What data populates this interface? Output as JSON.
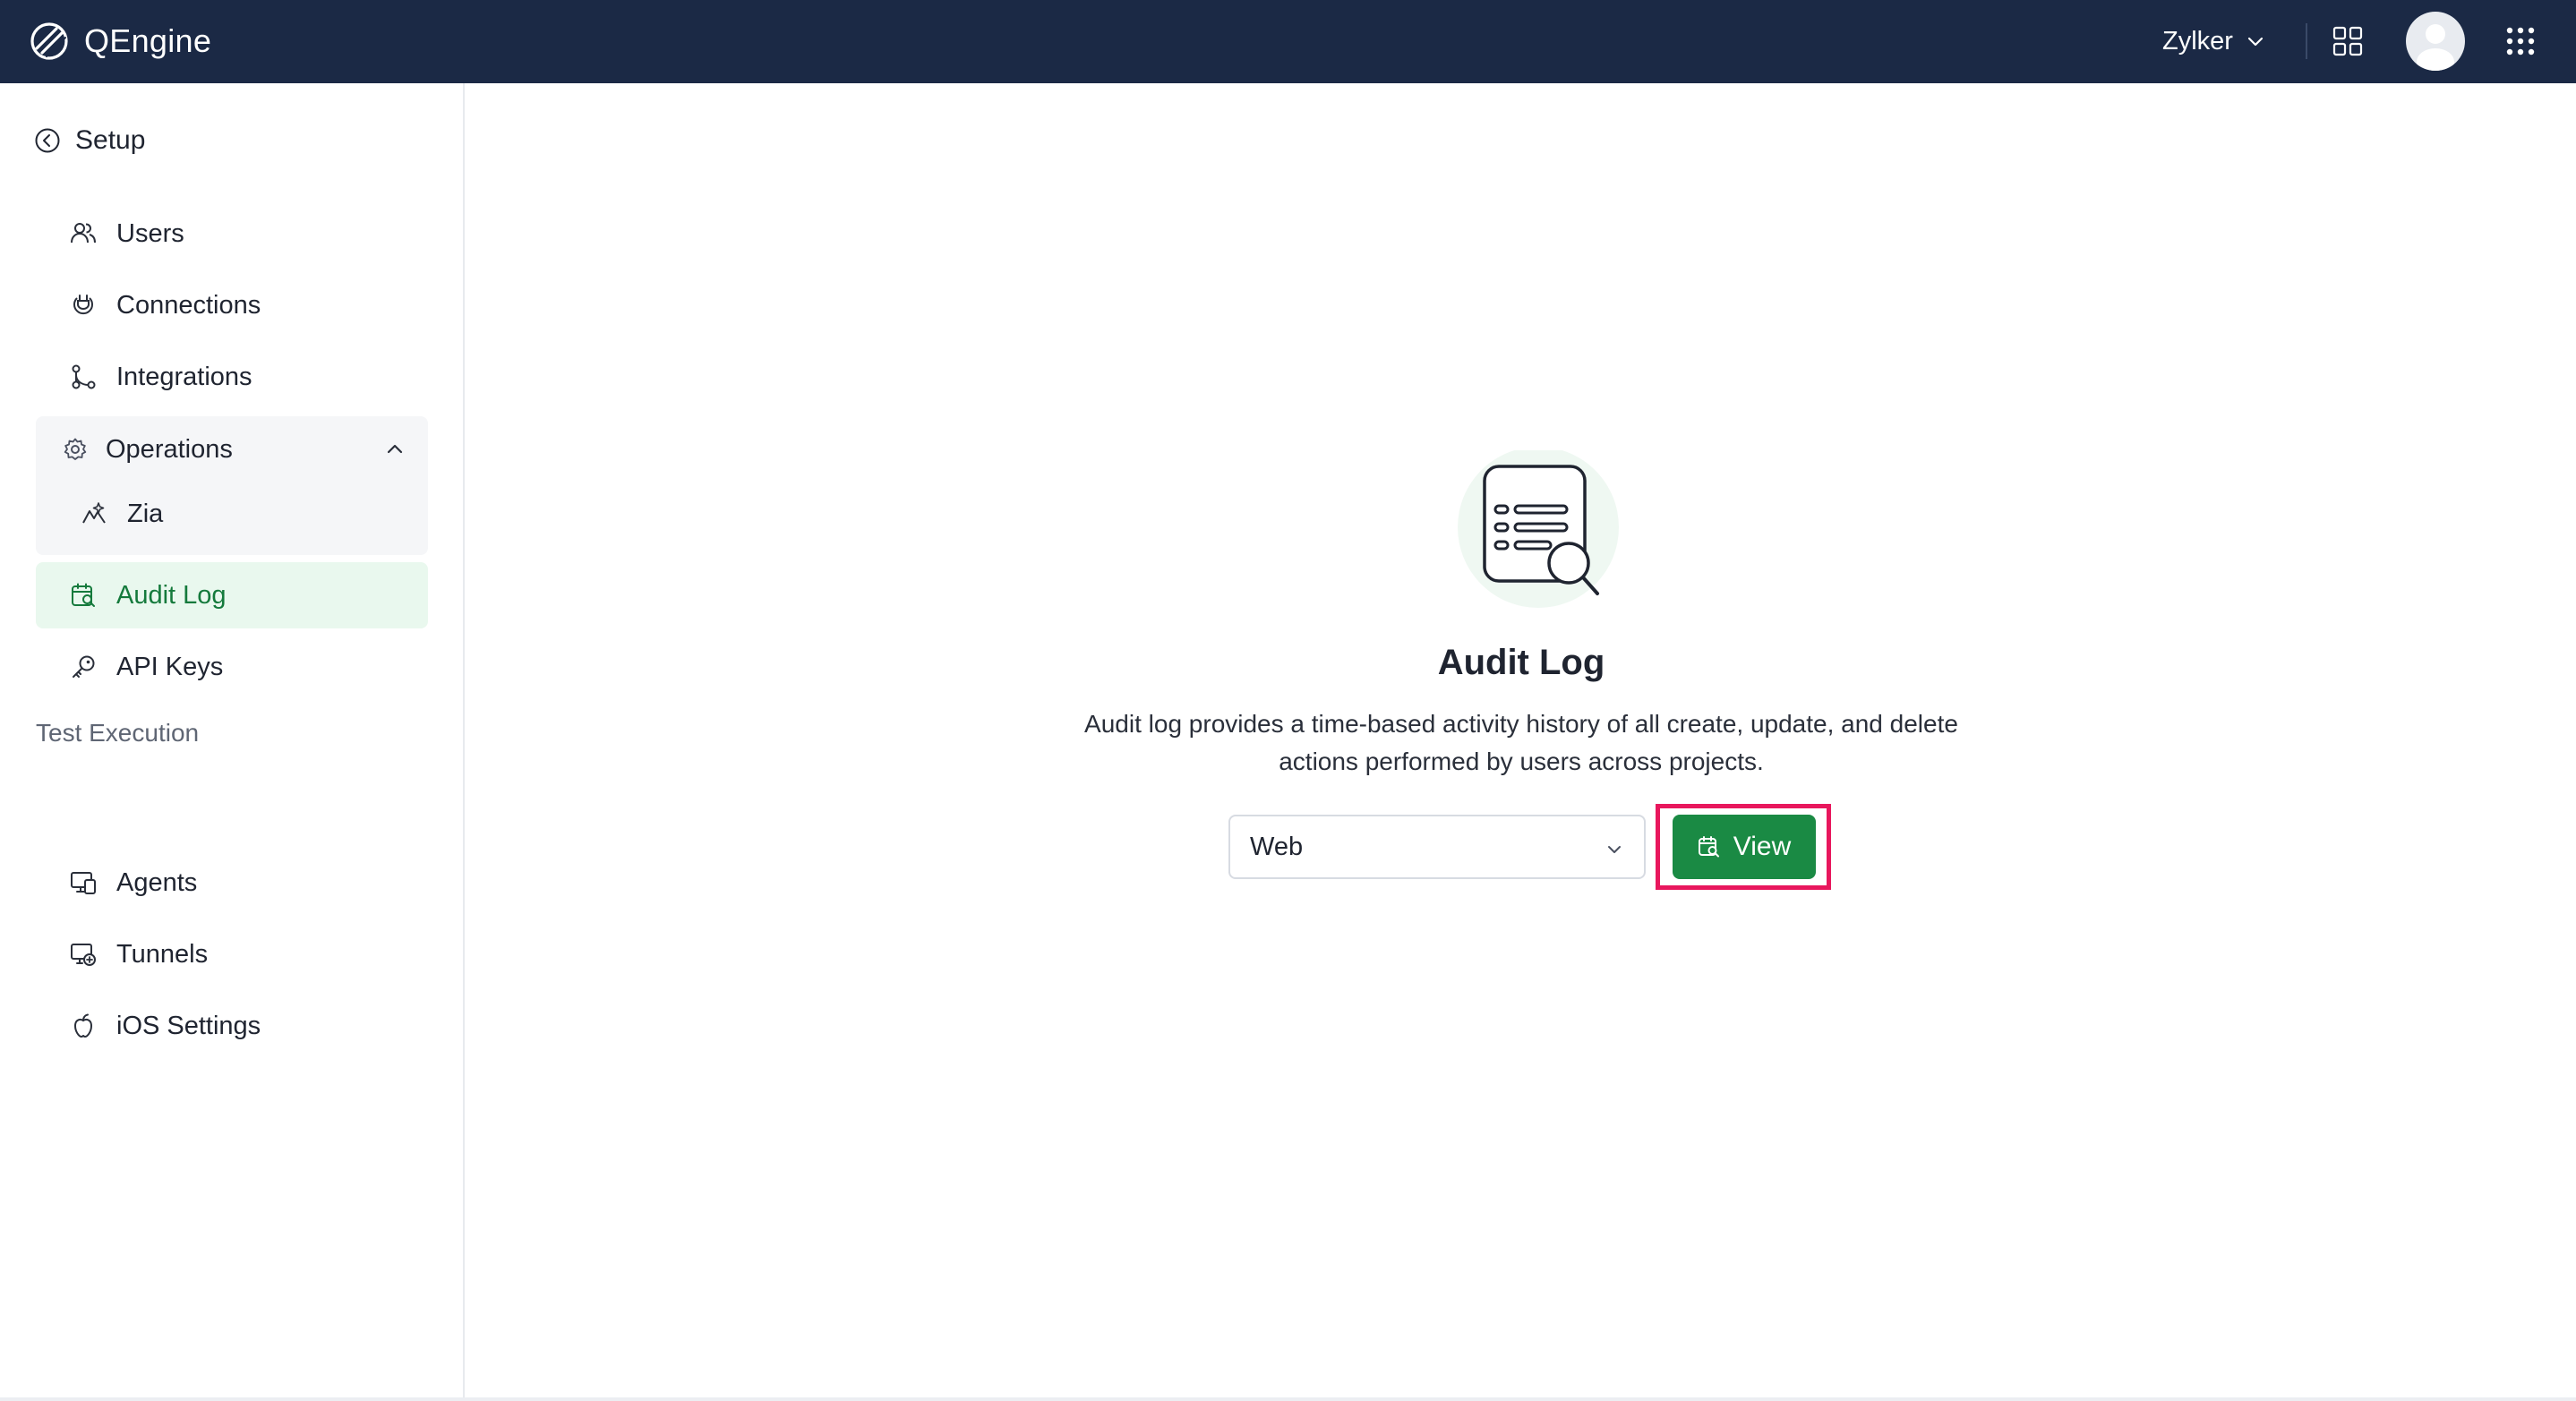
{
  "app": {
    "name": "QEngine"
  },
  "header": {
    "org_name": "Zylker"
  },
  "sidebar": {
    "back_label": "Setup",
    "items": [
      {
        "label": "Users",
        "icon": "users-icon"
      },
      {
        "label": "Connections",
        "icon": "connections-icon"
      },
      {
        "label": "Integrations",
        "icon": "integrations-icon"
      }
    ],
    "operations": {
      "label": "Operations",
      "icon": "gear-icon",
      "expanded": true,
      "children": [
        {
          "label": "Zia",
          "icon": "zia-icon"
        }
      ]
    },
    "items_after": [
      {
        "label": "Audit Log",
        "icon": "audit-log-icon",
        "active": true
      },
      {
        "label": "API Keys",
        "icon": "key-icon"
      }
    ],
    "section_test_execution": "Test Execution",
    "test_items": [
      {
        "label": "Agents",
        "icon": "agents-icon"
      },
      {
        "label": "Tunnels",
        "icon": "tunnels-icon"
      },
      {
        "label": "iOS Settings",
        "icon": "apple-icon"
      }
    ]
  },
  "main": {
    "title": "Audit Log",
    "description": "Audit log provides a time-based activity history of all create, update, and delete actions performed by users across projects.",
    "platform_select": {
      "value": "Web"
    },
    "view_button": "View"
  },
  "colors": {
    "topbar": "#1b2945",
    "accent_green": "#1a8a44",
    "active_bg": "#e9f8ee",
    "highlight": "#e8175d"
  }
}
